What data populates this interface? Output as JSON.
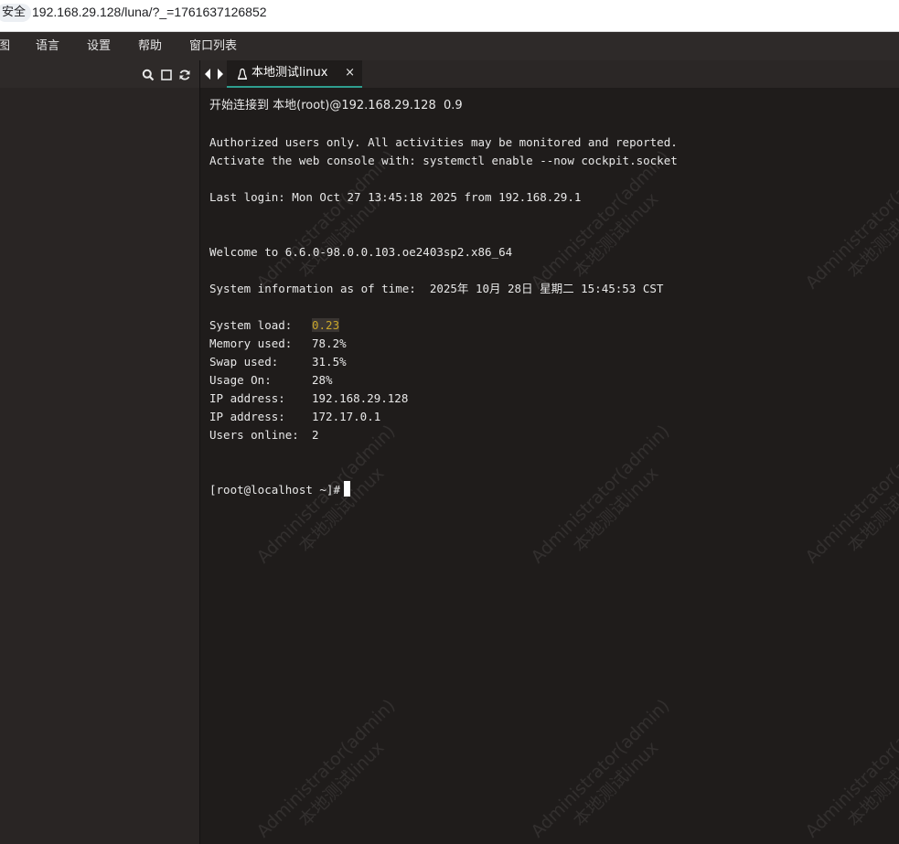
{
  "browser": {
    "security_label": "安全",
    "url": "192.168.29.128/luna/?_=1761637126852"
  },
  "menu": [
    {
      "label": "图"
    },
    {
      "label": "语言"
    },
    {
      "label": "设置"
    },
    {
      "label": "帮助"
    },
    {
      "label": "窗口列表"
    }
  ],
  "left_toolbar": {
    "icons": [
      "search-icon",
      "square-icon",
      "refresh-icon"
    ]
  },
  "tab": {
    "label": "本地测试linux",
    "close": "×"
  },
  "terminal": {
    "lines": {
      "connect": "开始连接到 本地(root)@192.168.29.128  0.9",
      "auth": "Authorized users only. All activities may be monitored and reported.",
      "activate": "Activate the web console with: systemctl enable --now cockpit.socket",
      "last_login": "Last login: Mon Oct 27 13:45:18 2025 from 192.168.29.1",
      "welcome": "Welcome to 6.6.0-98.0.0.103.oe2403sp2.x86_64",
      "sysinfo": "System information as of time:  2025年 10月 28日 星期二 15:45:53 CST"
    },
    "stats": [
      {
        "label": "System load:",
        "value": "0.23"
      },
      {
        "label": "Memory used:",
        "value": "78.2%"
      },
      {
        "label": "Swap used:",
        "value": "31.5%"
      },
      {
        "label": "Usage On:",
        "value": "28%"
      },
      {
        "label": "IP address:",
        "value": "192.168.29.128"
      },
      {
        "label": "IP address:",
        "value": "172.17.0.1"
      },
      {
        "label": "Users online:",
        "value": "2"
      }
    ],
    "prompt": "[root@localhost ~]#"
  },
  "watermark": {
    "line1": "Administrator(admin)",
    "line2": "本地测试linux"
  },
  "colors": {
    "terminal_bg": "#1f1c1b",
    "menu_bg": "#2e2a29",
    "tab_accent": "#2f9e8f",
    "load_highlight": "#c8a52a"
  }
}
